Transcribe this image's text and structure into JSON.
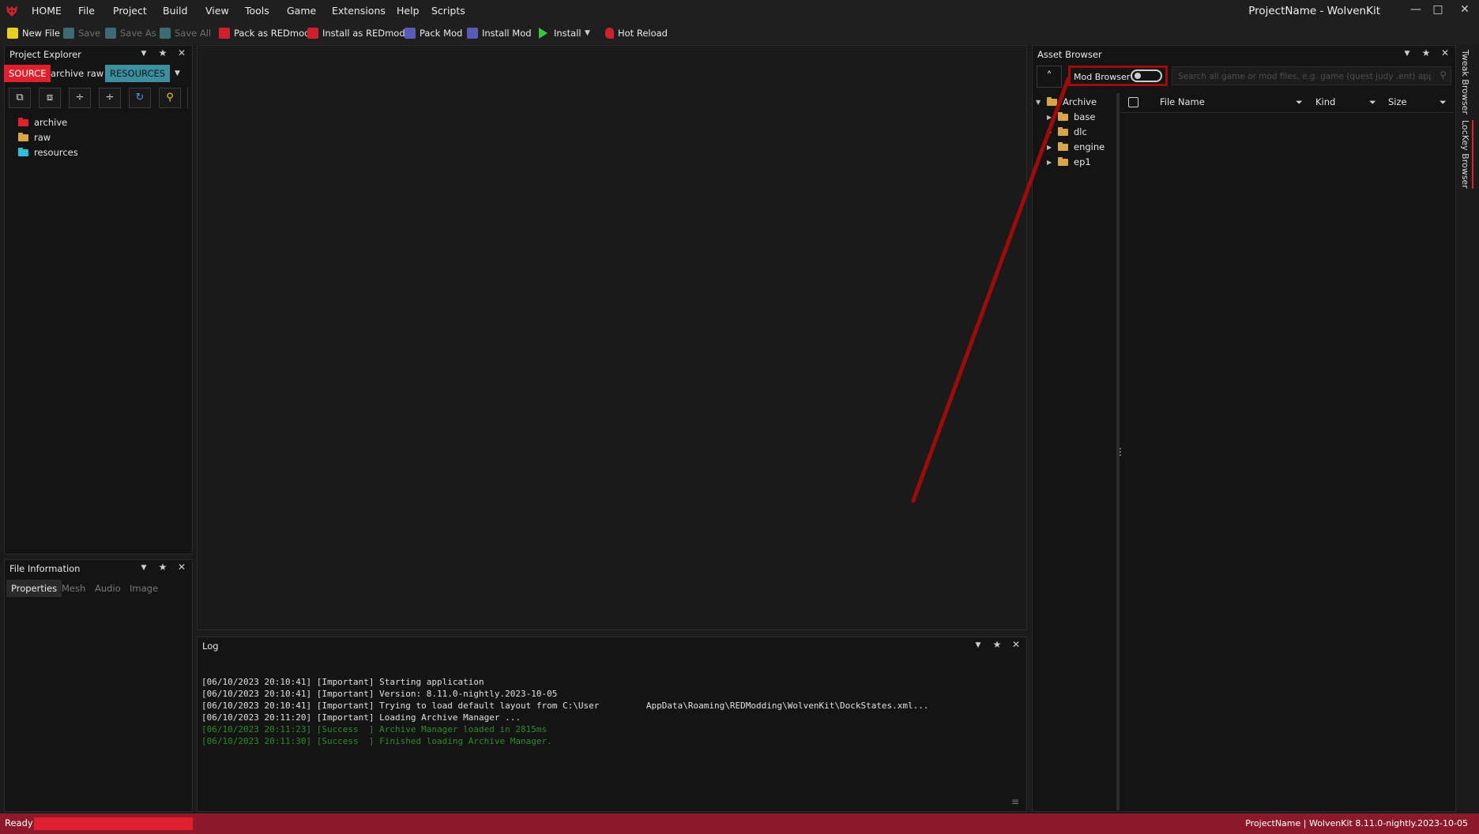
{
  "menu": {
    "items": [
      "HOME",
      "File",
      "Project",
      "Build",
      "View",
      "Tools",
      "Game",
      "Extensions",
      "Help",
      "Scripts"
    ],
    "window_title": "ProjectName - WolvenKit"
  },
  "toolbar": {
    "new_file": "New File",
    "save": "Save",
    "save_as": "Save As",
    "save_all": "Save All",
    "pack_redmod": "Pack as REDmod",
    "install_redmod": "Install as REDmod",
    "pack_mod": "Pack Mod",
    "install_mod": "Install Mod",
    "install": "Install",
    "hot_reload": "Hot Reload"
  },
  "project_explorer": {
    "title": "Project Explorer",
    "tabs": [
      "SOURCE",
      "archive",
      "raw",
      "RESOURCES"
    ],
    "tree": [
      {
        "label": "archive",
        "color": "#e0202e"
      },
      {
        "label": "raw",
        "color": "#d9a54a"
      },
      {
        "label": "resources",
        "color": "#2ec0d8"
      }
    ]
  },
  "file_information": {
    "title": "File Information",
    "tabs": [
      "Properties",
      "Mesh",
      "Audio",
      "Image"
    ]
  },
  "log": {
    "title": "Log",
    "lines": [
      {
        "text": "[06/10/2023 20:10:41] [Important] Starting application",
        "status": "important"
      },
      {
        "text": "[06/10/2023 20:10:41] [Important] Version: 8.11.0-nightly.2023-10-05",
        "status": "important"
      },
      {
        "text": "[06/10/2023 20:10:41] [Important] Trying to load default layout from C:\\User         AppData\\Roaming\\REDModding\\WolvenKit\\DockStates.xml...",
        "status": "important"
      },
      {
        "text": "[06/10/2023 20:11:20] [Important] Loading Archive Manager ...",
        "status": "important"
      },
      {
        "text": "[06/10/2023 20:11:23] [Success  ] Archive Manager loaded in 2815ms",
        "status": "success"
      },
      {
        "text": "[06/10/2023 20:11:30] [Success  ] Finished loading Archive Manager.",
        "status": "success"
      }
    ]
  },
  "asset_browser": {
    "title": "Asset Browser",
    "mod_browser_label": "Mod Browser",
    "mod_browser_on": false,
    "search_placeholder": "Search all game or mod files, e.g. game (quest judy .ent) appl.mesh",
    "tree_root": "Archive",
    "tree_children": [
      "base",
      "dlc",
      "engine",
      "ep1"
    ],
    "columns": [
      "File Name",
      "Kind",
      "Size"
    ]
  },
  "side_tabs": [
    "Tweak Browser",
    "LocKey Browser"
  ],
  "status": {
    "left": "Ready",
    "right": "ProjectName | WolvenKit 8.11.0-nightly.2023-10-05"
  },
  "colors": {
    "accent_red": "#e0202e",
    "status_bar": "#8c1a2a",
    "resources_tab": "#3d8e9e",
    "annotation": "#9e0b0b",
    "log_success": "#2e8b2e"
  }
}
